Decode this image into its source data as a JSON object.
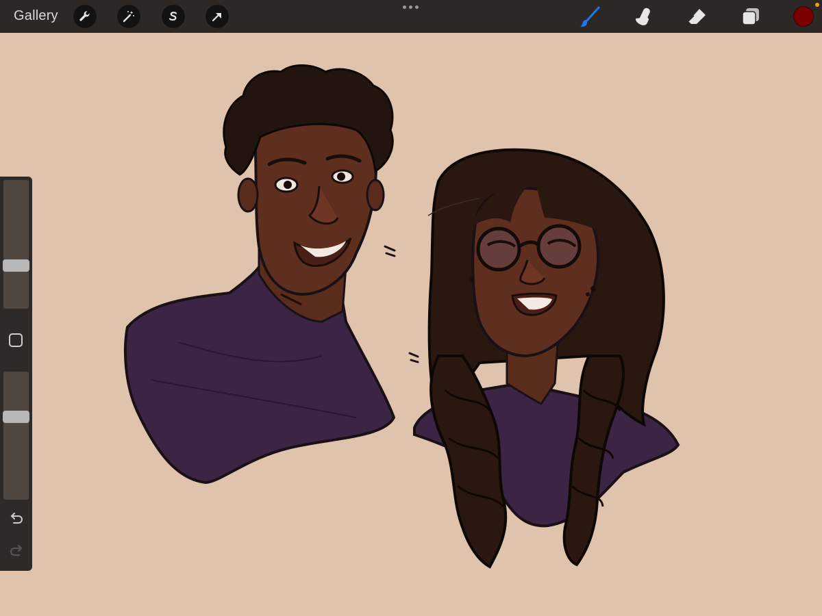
{
  "toolbar": {
    "gallery_label": "Gallery",
    "left_tools": [
      "wrench-icon",
      "magic-wand-icon",
      "selection-s-icon",
      "transform-arrow-icon"
    ],
    "right_tools": [
      "brush-icon",
      "smudge-icon",
      "eraser-icon",
      "layers-icon"
    ],
    "active_tool": "brush",
    "current_color": "#7a0000"
  },
  "sidebar": {
    "brush_size_level": 0.32,
    "opacity_level": 0.66
  },
  "colors": {
    "canvas_bg": "#dfc3ad",
    "toolbar_bg": "#2c2826",
    "brush_active": "#1e78f0"
  }
}
